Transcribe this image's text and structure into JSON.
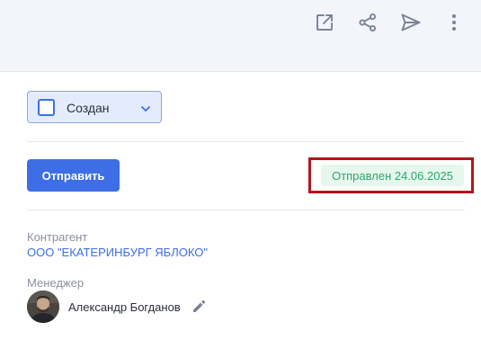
{
  "toolbar": {
    "icons": [
      "external-link-icon",
      "share-icon",
      "send-icon",
      "more-vertical-icon"
    ],
    "icon_color": "#7a8396"
  },
  "status": {
    "selected": "Создан",
    "accent": "#3d6ee5"
  },
  "actions": {
    "send_label": "Отправить"
  },
  "sent_status": {
    "label": "Отправлен 24.06.2025",
    "color": "#2aa86a",
    "highlight_color": "#b3151b"
  },
  "counterparty": {
    "label": "Контрагент",
    "value": "ООО \"ЕКАТЕРИНБУРГ ЯБЛОКО\""
  },
  "manager": {
    "label": "Менеджер",
    "name": "Александр Богданов"
  }
}
